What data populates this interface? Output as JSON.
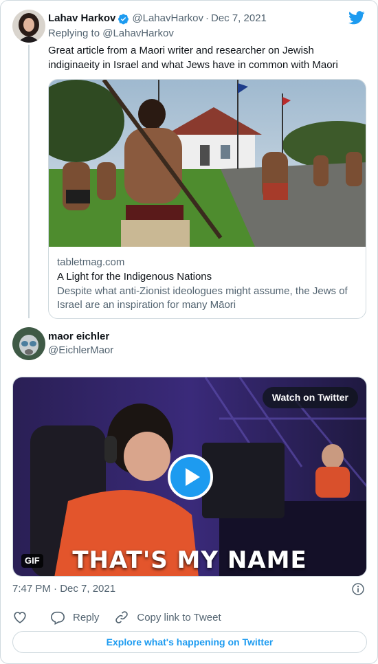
{
  "tweet1": {
    "author_name": "Lahav Harkov",
    "handle": "@LahavHarkov",
    "separator": "·",
    "date": "Dec 7, 2021",
    "replying_to": "Replying to @LahavHarkov",
    "text": "Great article from a Maori writer and researcher on Jewish indiginaeity in Israel and what Jews have in common with Maori",
    "link_card": {
      "domain": "tabletmag.com",
      "title": "A Light for the Indigenous Nations",
      "description": "Despite what anti-Zionist ideologues might assume, the Jews of Israel are an inspiration for many Māori"
    }
  },
  "tweet2": {
    "author_name": "maor eichler",
    "handle": "@EichlerMaor",
    "media": {
      "watch_label": "Watch on Twitter",
      "gif_label": "GIF",
      "caption": "THAT'S MY NAME"
    },
    "timestamp": "7:47 PM · Dec 7, 2021",
    "actions": {
      "reply_label": "Reply",
      "copy_label": "Copy link to Tweet"
    },
    "explore_label": "Explore what's happening on Twitter"
  },
  "icons": {
    "brand": "twitter-bird-icon",
    "verified": "verified-badge-icon",
    "like": "heart-icon",
    "reply": "speech-bubble-icon",
    "copy": "link-icon",
    "info": "info-icon",
    "play": "play-icon"
  },
  "colors": {
    "accent": "#1d9bf0",
    "text_primary": "#0f1419",
    "text_secondary": "#536471",
    "border": "#cfd9de"
  }
}
